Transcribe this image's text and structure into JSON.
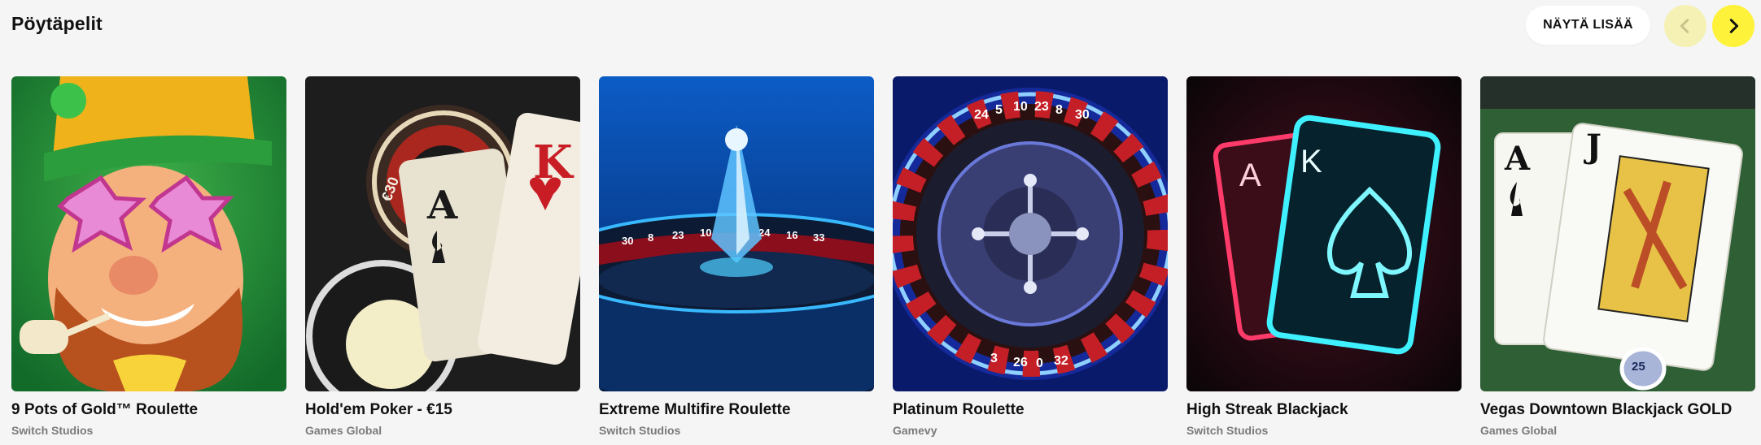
{
  "section": {
    "title": "Pöytäpelit",
    "show_more_label": "NÄYTÄ LISÄÄ",
    "prev_icon": "chevron-left-icon",
    "next_icon": "chevron-right-icon",
    "colors": {
      "accent": "#fff23b",
      "accent_dim": "#f5f1b4",
      "background": "#f5f5f5"
    }
  },
  "games": [
    {
      "name": "9 Pots of Gold™ Roulette",
      "provider": "Switch Studios"
    },
    {
      "name": "Hold'em Poker - €15",
      "provider": "Games Global"
    },
    {
      "name": "Extreme Multifire Roulette",
      "provider": "Switch Studios"
    },
    {
      "name": "Platinum Roulette",
      "provider": "Gamevy"
    },
    {
      "name": "High Streak Blackjack",
      "provider": "Switch Studios"
    },
    {
      "name": "Vegas Downtown Blackjack GOLD",
      "provider": "Games Global"
    }
  ],
  "artwork": {
    "holdem_card_left": "A",
    "holdem_card_right": "K",
    "holdem_chip": "€30",
    "multifire_numbers": [
      "30",
      "8",
      "23",
      "10",
      "24",
      "16",
      "33"
    ],
    "platinum_numbers_top": [
      "24",
      "5",
      "10",
      "23",
      "8",
      "30"
    ],
    "platinum_numbers_bottom": [
      "3",
      "26",
      "0",
      "32"
    ],
    "streak_card_left": "A",
    "streak_card_right": "K",
    "vegas_card_left": "A",
    "vegas_card_right": "J",
    "vegas_chip": "25"
  }
}
